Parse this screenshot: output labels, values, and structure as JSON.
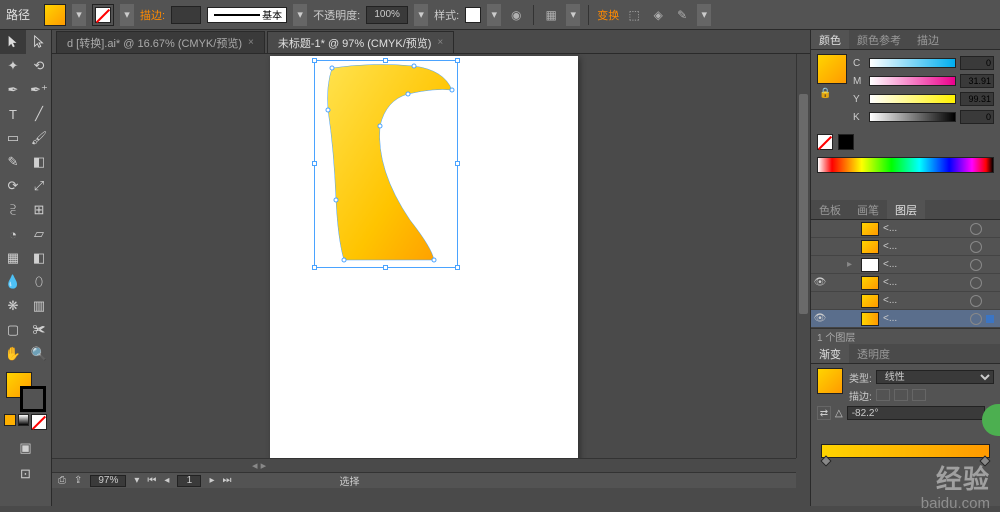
{
  "top": {
    "title": "路径",
    "stroke_label": "描边:",
    "stroke_style_label": "基本",
    "opacity_label": "不透明度:",
    "opacity_value": "100%",
    "style_label": "样式:",
    "transform_label": "变换"
  },
  "tabs": [
    {
      "label": "d [转换].ai* @ 16.67% (CMYK/预览)",
      "active": false
    },
    {
      "label": "未标题-1* @ 97% (CMYK/预览)",
      "active": true
    }
  ],
  "status": {
    "zoom": "97%",
    "page": "1",
    "mode": "选择"
  },
  "color_panel": {
    "tabs": [
      "颜色",
      "颜色参考",
      "描边"
    ],
    "sliders": [
      {
        "label": "C",
        "value": "0",
        "gradient": "linear-gradient(90deg,#fff,#00aeef)"
      },
      {
        "label": "M",
        "value": "31.91",
        "gradient": "linear-gradient(90deg,#fff,#ec008c)"
      },
      {
        "label": "Y",
        "value": "99.31",
        "gradient": "linear-gradient(90deg,#fff,#fff200)"
      },
      {
        "label": "K",
        "value": "0",
        "gradient": "linear-gradient(90deg,#fff,#000)"
      }
    ]
  },
  "layers_panel": {
    "tabs": [
      "色板",
      "画笔",
      "图层"
    ],
    "layers": [
      {
        "name": "<...",
        "thumb": "linear-gradient(135deg,#ffd400,#ff9a00)",
        "selected": false,
        "visible": false
      },
      {
        "name": "<...",
        "thumb": "linear-gradient(135deg,#ffd400,#ff9a00)",
        "selected": false,
        "visible": false
      },
      {
        "name": "<...",
        "thumb": "#fff",
        "selected": false,
        "visible": false,
        "arrow": true
      },
      {
        "name": "<...",
        "thumb": "linear-gradient(135deg,#ffd400,#ff9a00)",
        "selected": false,
        "visible": true
      },
      {
        "name": "<...",
        "thumb": "linear-gradient(135deg,#ffd400,#ff9a00)",
        "selected": false,
        "visible": false
      },
      {
        "name": "<...",
        "thumb": "linear-gradient(90deg,#ffd400,#ff9a00)",
        "selected": true,
        "visible": true
      }
    ],
    "footer": "1 个图层"
  },
  "gradient_panel": {
    "tabs": [
      "渐变",
      "透明度"
    ],
    "type_label": "类型:",
    "type_value": "线性",
    "stroke_label": "描边:",
    "angle_value": "-82.2°"
  },
  "watermark": "经验",
  "watermark_sub": "baidu.com"
}
